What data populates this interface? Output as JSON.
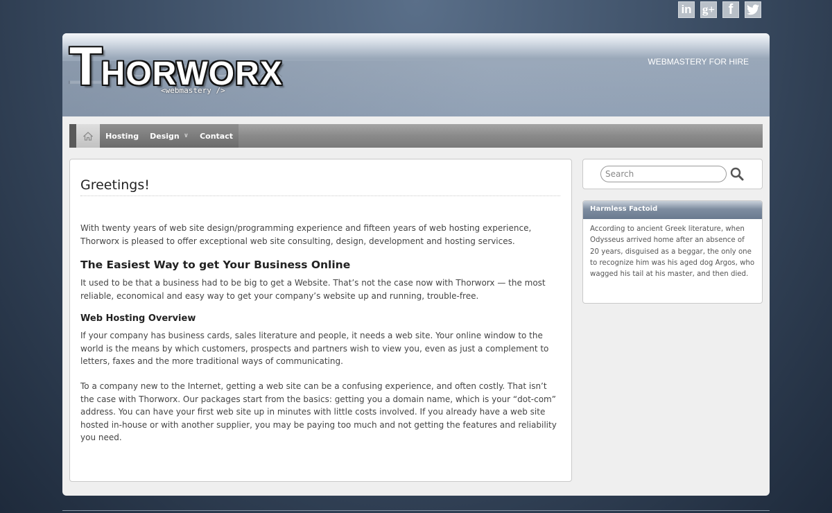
{
  "social": [
    {
      "name": "linkedin-icon",
      "glyph": "in"
    },
    {
      "name": "googleplus-icon",
      "glyph": "g+"
    },
    {
      "name": "facebook-icon",
      "glyph": "f"
    },
    {
      "name": "twitter-icon",
      "glyph": "t"
    }
  ],
  "header": {
    "logo_big": "T",
    "logo_rest": "HORWORX",
    "logo_sub": "<webmastery />",
    "tagline": "WEBMASTERY FOR HIRE"
  },
  "nav": {
    "home_icon": "home-icon",
    "items": [
      "Hosting",
      "Design",
      "Contact"
    ]
  },
  "main": {
    "title": "Greetings!",
    "intro": "With twenty years of web site design/programming experience and fifteen years of web hosting experience, Thorworx is pleased to offer exceptional web site consulting, design, development and hosting services.",
    "h2": "The Easiest Way to get Your Business Online",
    "p2": "It used to be that a business had to be big to get a Website. That’s not the case now with Thorworx — the most reliable, economical and easy way to get your company’s website up and running, trouble-free.",
    "h3": "Web Hosting Overview",
    "p3": "If your company has business cards, sales literature and people, it needs a web site. Your online window to the world is the means by which customers, prospects and partners wish to view you, even as just a complement to letters, faxes and the more traditional ways of communicating.",
    "p4": "To a company new to the Internet, getting a web site can be a confusing experience, and often costly. That isn’t the case with Thorworx. Our packages start from the basics: getting you a domain name, which is your “dot-com” address. You can have your first web site up in minutes with little costs involved. If you already have a web site hosted in-house or with another supplier, you may be paying too much and not getting the features and reliability you need."
  },
  "sidebar": {
    "search_placeholder": "Search",
    "factoid_title": "Harmless Factoid",
    "factoid_body": "According to ancient Greek literature, when Odysseus arrived home after an absence of 20 years, disguised as a beggar, the only one to recognize him was his aged dog Argos, who wagged his tail at his master, and then died."
  }
}
